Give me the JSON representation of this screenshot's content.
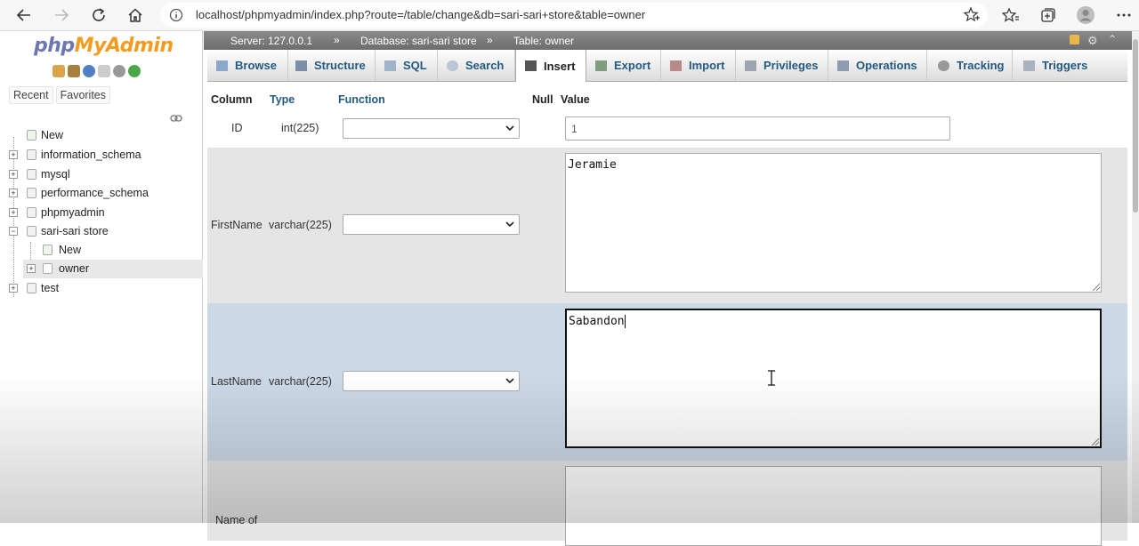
{
  "browser": {
    "url": "localhost/phpmyadmin/index.php?route=/table/change&db=sari-sari+store&table=owner"
  },
  "nav": {
    "logo_part1": "php",
    "logo_part2": "MyAdmin",
    "tab_recent": "Recent",
    "tab_favorites": "Favorites",
    "tree": [
      {
        "label": "New"
      },
      {
        "label": "information_schema"
      },
      {
        "label": "mysql"
      },
      {
        "label": "performance_schema"
      },
      {
        "label": "phpmyadmin"
      },
      {
        "label": "sari-sari store"
      },
      {
        "label": "New"
      },
      {
        "label": "owner"
      },
      {
        "label": "test"
      }
    ]
  },
  "breadcrumb": {
    "server": "Server: 127.0.0.1",
    "database": "Database: sari-sari store",
    "table": "Table: owner",
    "separator": "»"
  },
  "tabs": [
    "Browse",
    "Structure",
    "SQL",
    "Search",
    "Insert",
    "Export",
    "Import",
    "Privileges",
    "Operations",
    "Tracking",
    "Triggers"
  ],
  "active_tab": "Insert",
  "table": {
    "headers": {
      "column": "Column",
      "type": "Type",
      "function": "Function",
      "null": "Null",
      "value": "Value"
    },
    "rows": [
      {
        "column": "ID",
        "type": "int(225)",
        "value": "1"
      },
      {
        "column": "FirstName",
        "type": "varchar(225)",
        "value": "Jeramie"
      },
      {
        "column": "LastName",
        "type": "varchar(225)",
        "value": "Sabandon"
      },
      {
        "column": "Name of",
        "type": "",
        "value": ""
      }
    ]
  },
  "colors": {
    "accent_link": "#235a81",
    "crumb_bg": "#7a7a7a",
    "row_alt": "#e5e5e5",
    "row_hover": "#ccd8e6"
  }
}
